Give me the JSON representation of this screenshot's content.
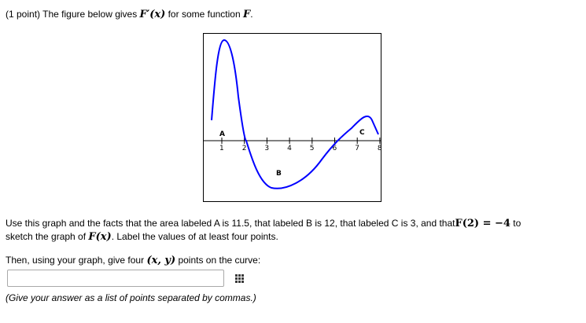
{
  "problem": {
    "header_prefix": "(1 point) The figure below gives ",
    "header_math": "F′(x)",
    "header_mid": " for some function ",
    "header_math2": "F",
    "header_end": "."
  },
  "figure": {
    "x_ticks": [
      "1",
      "2",
      "3",
      "4",
      "5",
      "6",
      "7",
      "8"
    ],
    "region_labels": [
      "A",
      "B",
      "C"
    ],
    "curve_color": "#0000ff"
  },
  "instructions": {
    "line1_text": "Use this graph and the facts that the area labeled A is 11.5, that labeled B is 12, that labeled C is 3, and that",
    "line1_math": "F(2) = −4",
    "line1_end": " to",
    "line2_prefix": "sketch the graph of ",
    "line2_math": "F(x)",
    "line2_end": ". Label the values of at least four points."
  },
  "prompt": {
    "text": "Then, using your graph, give four ",
    "math": "(x, y)",
    "end": " points on the curve:"
  },
  "answer": {
    "value": "",
    "placeholder": ""
  },
  "hint": "(Give your answer as a list of points separated by commas.)"
}
